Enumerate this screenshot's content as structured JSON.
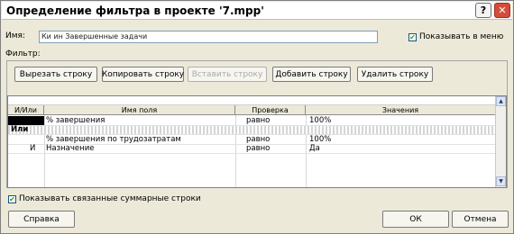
{
  "window": {
    "title": "Определение фильтра в проекте '7.mpp'",
    "help_symbol": "?",
    "close_symbol": "✕"
  },
  "name": {
    "label": "Имя:",
    "value": "Ки ин Завершенные задачи"
  },
  "show_in_menu": {
    "label": "Показывать в меню",
    "checked": true
  },
  "filter": {
    "label": "Фильтр:",
    "buttons": {
      "cut": "Вырезать строку",
      "copy": "Копировать строку",
      "paste": "Вставить строку",
      "add": "Добавить строку",
      "delete": "Удалить строку"
    }
  },
  "grid": {
    "headers": {
      "andor": "И/Или",
      "field": "Имя поля",
      "test": "Проверка",
      "value": "Значения"
    },
    "rows": [
      {
        "andor": "",
        "field": "% завершения",
        "test": "равно",
        "value": "100%"
      },
      {
        "andor": "Или",
        "field": "",
        "test": "",
        "value": ""
      },
      {
        "andor": "",
        "field": "% завершения по трудозатратам",
        "test": "равно",
        "value": "100%"
      },
      {
        "andor": "И",
        "field": "Назначение",
        "test": "равно",
        "value": "Да"
      }
    ]
  },
  "show_summary": {
    "label": "Показывать связанные суммарные строки",
    "checked": true
  },
  "footer": {
    "help": "Справка",
    "ok": "ОК",
    "cancel": "Отмена"
  },
  "icons": {
    "check": "✔",
    "scroll_up": "▲",
    "scroll_down": "▼"
  }
}
